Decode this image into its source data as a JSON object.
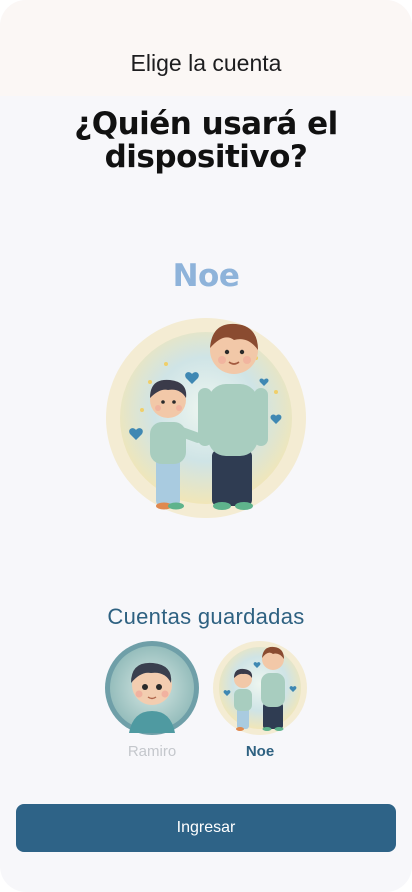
{
  "header": {
    "title": "Elige la cuenta"
  },
  "main": {
    "question": "¿Quién usará el dispositivo?",
    "selected_name": "Noe"
  },
  "saved": {
    "title": "Cuentas guardadas",
    "accounts": [
      {
        "name": "Ramiro",
        "selected": false,
        "avatar": "boy-avatar-icon"
      },
      {
        "name": "Noe",
        "selected": true,
        "avatar": "father-and-son-avatar-icon"
      }
    ]
  },
  "actions": {
    "enter_label": "Ingresar"
  },
  "colors": {
    "accent": "#2e6387",
    "selected_name": "#8eb3da",
    "inactive": "#c4c7cc"
  }
}
